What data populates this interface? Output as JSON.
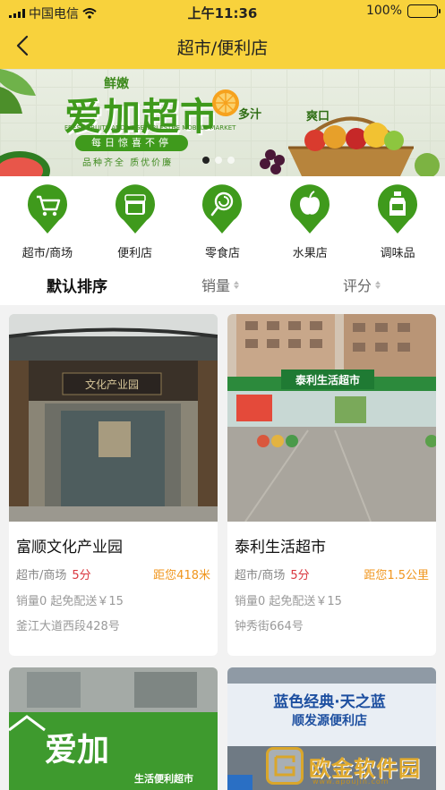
{
  "status_bar": {
    "carrier": "中国电信",
    "time": "上午11:36",
    "battery": "100%"
  },
  "nav": {
    "title": "超市/便利店"
  },
  "banner": {
    "tag": "鲜嫩",
    "title": "爱加超市",
    "subtitle_en": "FRESH FRUITS AND VEGETABLESTHE MOBI LE MARKET",
    "slogan": "每日惊喜不停",
    "tagline": "品种齐全 质优价廉",
    "word1": "多汁",
    "word2": "爽口",
    "dots": 3,
    "active_dot": 0
  },
  "categories": [
    {
      "label": "超市/商场",
      "icon": "cart-icon"
    },
    {
      "label": "便利店",
      "icon": "store-icon"
    },
    {
      "label": "零食店",
      "icon": "lollipop-icon"
    },
    {
      "label": "水果店",
      "icon": "apple-icon"
    },
    {
      "label": "调味品",
      "icon": "bottle-icon"
    }
  ],
  "sort": {
    "default": "默认排序",
    "sales": "销量",
    "rating": "评分"
  },
  "stores": [
    {
      "name": "富顺文化产业园",
      "category": "超市/商场",
      "score": "5分",
      "distance": "距您418米",
      "delivery": "销量0 起免配送￥15",
      "address": "釜江大道西段428号",
      "sign": "文化产业园"
    },
    {
      "name": "泰利生活超市",
      "category": "超市/商场",
      "score": "5分",
      "distance": "距您1.5公里",
      "delivery": "销量0 起免配送￥15",
      "address": "钟秀街664号",
      "sign": "泰利生活超市"
    },
    {
      "name": "",
      "sign": "爱加",
      "sign_sub": "生活便利超市"
    },
    {
      "name": "",
      "sign": "蓝色经典·天之蓝",
      "sign_sub": "顺发源便利店"
    }
  ],
  "watermark": {
    "text": "欧金软件园",
    "url": "www.apoujin.com"
  },
  "colors": {
    "brand_yellow": "#f8d23c",
    "icon_green": "#3f9a1c",
    "score_red": "#d9363e",
    "distance_orange": "#f0961e"
  }
}
